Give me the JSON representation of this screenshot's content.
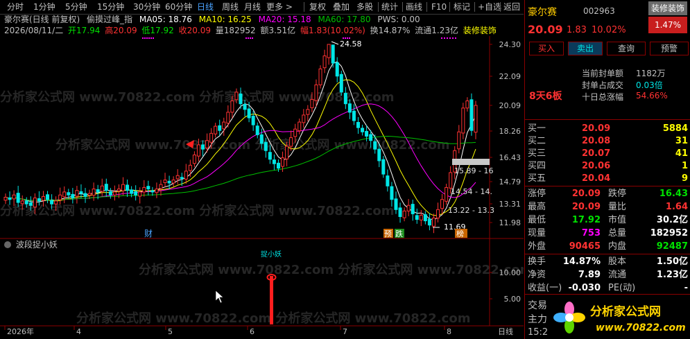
{
  "toolbar": {
    "periods": [
      "分时",
      "1分钟",
      "5分钟",
      "15分钟",
      "30分钟",
      "60分钟",
      "日线",
      "周线",
      "月线",
      "更多 >"
    ],
    "active_period": "日线",
    "right_items": [
      "复权",
      "叠加",
      "多股",
      "统计",
      "画线",
      "F10",
      "标记",
      "+自选",
      "返回"
    ]
  },
  "header": {
    "line1_title": "豪尔赛(日线 前复权)",
    "line1_indicator": "偷摸过峰_指",
    "ma5": "MA05: 18.76",
    "ma10": "MA10: 16.25",
    "ma20": "MA20: 15.18",
    "ma60": "MA60: 17.80",
    "pws": "PWS: 0.00",
    "line2_date": "2026/08/11/二",
    "open": "开17.94",
    "high": "高20.09",
    "low": "低17.92",
    "close": "收20.09",
    "volume": "量182952",
    "amount": "额3.51亿",
    "amp": "幅1.83(10.02%)",
    "turnover": "换14.87%",
    "float": "流通1.23亿",
    "industry": "装修装饰"
  },
  "price_axis": [
    "24.30",
    "22.09",
    "20.09",
    "18.26",
    "16.43",
    "14.79",
    "13.31",
    "11.98"
  ],
  "price_annotations": {
    "max_label": "24.58",
    "min_label": "11.69",
    "box1": "15.89 - 16",
    "box2": "14.54 - 14.",
    "box3": "13.22 - 13.3"
  },
  "event_labels": {
    "cai": "财",
    "yu": "预",
    "die": "跌",
    "bang": "榜"
  },
  "indicator": {
    "name": "波段捉小妖",
    "signal_label": "捉小妖",
    "axis": [
      "10.00",
      "5.00"
    ]
  },
  "date_axis": {
    "labels": [
      "2026年",
      "4",
      "5",
      "6",
      "7",
      "8"
    ],
    "period": "日线"
  },
  "stock": {
    "name": "豪尔赛",
    "code": "002963",
    "sector_badge": "装修装饰",
    "sector_pct": "1.47%",
    "price": "20.09",
    "change": "1.83",
    "change_pct": "10.02%"
  },
  "buttons": [
    "买入",
    "卖出",
    "查询",
    "预警"
  ],
  "limit_info": {
    "l1_label": "当前封单额",
    "l1_value": "1182万",
    "l2_label": "封单占成交",
    "l2_value": "0.03倍",
    "l3_label": "十日总涨幅",
    "l3_value": "54.66%",
    "boards": "8天6板"
  },
  "order_book": [
    {
      "label": "买一",
      "price": "20.09",
      "vol": "5884"
    },
    {
      "label": "买二",
      "price": "20.08",
      "vol": "31"
    },
    {
      "label": "买三",
      "price": "20.07",
      "vol": "41"
    },
    {
      "label": "买四",
      "price": "20.06",
      "vol": "1"
    },
    {
      "label": "买五",
      "price": "20.04",
      "vol": "9"
    }
  ],
  "stats": {
    "zt_l": "涨停",
    "zt_v": "20.09",
    "dt_l": "跌停",
    "dt_v": "16.43",
    "zg_l": "最高",
    "zg_v": "20.09",
    "lb_l": "量比",
    "lb_v": "1.64",
    "zd_l": "最低",
    "zd_v": "17.92",
    "sz_l": "市值",
    "sz_v": "30.2亿",
    "xl_l": "现量",
    "xl_v": "753",
    "zl_l": "总量",
    "zl_v": "182952",
    "wp_l": "外盘",
    "wp_v": "90465",
    "np_l": "内盘",
    "np_v": "92487",
    "hs_l": "换手",
    "hs_v": "14.87%",
    "gb_l": "股本",
    "gb_v": "1.50亿",
    "jz_l": "净资",
    "jz_v": "7.89",
    "lt_l": "流通",
    "lt_v": "1.23亿",
    "sy_l": "收益(一)",
    "sy_v": "-0.030",
    "pe_l": "PE(动)",
    "pe_v": "-",
    "jy_l": "交易",
    "zl2_l": "主力",
    "time": "15:2"
  },
  "watermark": {
    "site": "www.70822.com",
    "brand": "分析家公式网"
  },
  "colors": {
    "up": "#ff3232",
    "down": "#00e5e5",
    "ma5": "#ffffff",
    "ma10": "#ffff00",
    "ma20": "#ff00ff",
    "ma60": "#00c000",
    "border": "#8b0000",
    "axis_text": "#c0c0c0"
  }
}
